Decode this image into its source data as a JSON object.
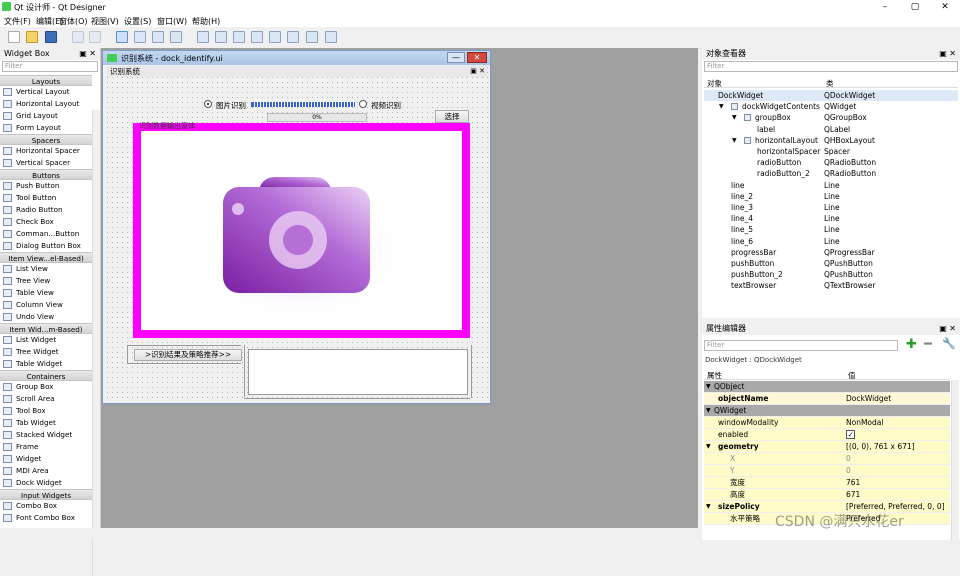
{
  "window": {
    "title": "Qt 设计师 - Qt Designer"
  },
  "menu": [
    "文件(F)",
    "编辑(E)",
    "窗体(O)",
    "视图(V)",
    "设置(S)",
    "窗口(W)",
    "帮助(H)"
  ],
  "widget_box": {
    "title": "Widget Box",
    "filter_placeholder": "Filter",
    "sections": [
      {
        "name": "Layouts",
        "items": [
          "Vertical Layout",
          "Horizontal Layout",
          "Grid Layout",
          "Form Layout"
        ]
      },
      {
        "name": "Spacers",
        "items": [
          "Horizontal Spacer",
          "Vertical Spacer"
        ]
      },
      {
        "name": "Buttons",
        "items": [
          "Push Button",
          "Tool Button",
          "Radio Button",
          "Check Box",
          "Comman...Button",
          "Dialog Button Box"
        ]
      },
      {
        "name": "Item View...el-Based)",
        "items": [
          "List View",
          "Tree View",
          "Table View",
          "Column View",
          "Undo View"
        ]
      },
      {
        "name": "Item Wid...m-Based)",
        "items": [
          "List Widget",
          "Tree Widget",
          "Table Widget"
        ]
      },
      {
        "name": "Containers",
        "items": [
          "Group Box",
          "Scroll Area",
          "Tool Box",
          "Tab Widget",
          "Stacked Widget",
          "Frame",
          "Widget",
          "MDI Area",
          "Dock Widget"
        ]
      },
      {
        "name": "Input Widgets",
        "items": [
          "Combo Box",
          "Font Combo Box"
        ]
      }
    ]
  },
  "form": {
    "window_title": "识别系统 - dock_identify.ui",
    "dock_title": "识别系统",
    "radio_image": "图片识别",
    "radio_video": "视频识别",
    "progress_text": "0%",
    "select_button": "选择",
    "groupbox_title": "识别数据输出窗体",
    "result_button": ">识别结果及策略推荐>>"
  },
  "object_inspector": {
    "title": "对象查看器",
    "filter_placeholder": "Filter",
    "col_object": "对象",
    "col_class": "类",
    "rows": [
      {
        "name": "DockWidget",
        "class": "QDockWidget"
      },
      {
        "name": "dockWidgetContents",
        "class": "QWidget"
      },
      {
        "name": "groupBox",
        "class": "QGroupBox"
      },
      {
        "name": "label",
        "class": "QLabel"
      },
      {
        "name": "horizontalLayout",
        "class": "QHBoxLayout"
      },
      {
        "name": "horizontalSpacer",
        "class": "Spacer"
      },
      {
        "name": "radioButton",
        "class": "QRadioButton"
      },
      {
        "name": "radioButton_2",
        "class": "QRadioButton"
      },
      {
        "name": "line",
        "class": "Line"
      },
      {
        "name": "line_2",
        "class": "Line"
      },
      {
        "name": "line_3",
        "class": "Line"
      },
      {
        "name": "line_4",
        "class": "Line"
      },
      {
        "name": "line_5",
        "class": "Line"
      },
      {
        "name": "line_6",
        "class": "Line"
      },
      {
        "name": "progressBar",
        "class": "QProgressBar"
      },
      {
        "name": "pushButton",
        "class": "QPushButton"
      },
      {
        "name": "pushButton_2",
        "class": "QPushButton"
      },
      {
        "name": "textBrowser",
        "class": "QTextBrowser"
      }
    ]
  },
  "property_editor": {
    "title": "属性编辑器",
    "filter_placeholder": "Filter",
    "context": "DockWidget : QDockWidget",
    "col_property": "属性",
    "col_value": "值",
    "rows": [
      {
        "name": "QObject",
        "value": ""
      },
      {
        "name": "objectName",
        "value": "DockWidget"
      },
      {
        "name": "QWidget",
        "value": ""
      },
      {
        "name": "windowModality",
        "value": "NonModal"
      },
      {
        "name": "enabled",
        "value": "✓"
      },
      {
        "name": "geometry",
        "value": "[(0, 0), 761 x 671]"
      },
      {
        "name": "X",
        "value": "0"
      },
      {
        "name": "Y",
        "value": "0"
      },
      {
        "name": "宽度",
        "value": "761"
      },
      {
        "name": "高度",
        "value": "671"
      },
      {
        "name": "sizePolicy",
        "value": "[Preferred, Preferred, 0, 0]"
      },
      {
        "name": "水平策略",
        "value": "Preferred"
      }
    ]
  },
  "watermark": "CSDN @满只水花er",
  "colors": {
    "groupbox_border": "#ff00ff",
    "selection": "#dde9f7",
    "qt_green": "#41cd52"
  },
  "icons": [
    "new-file-icon",
    "open-folder-icon",
    "save-icon",
    "copy-icon",
    "paste-icon",
    "camera-icon"
  ]
}
